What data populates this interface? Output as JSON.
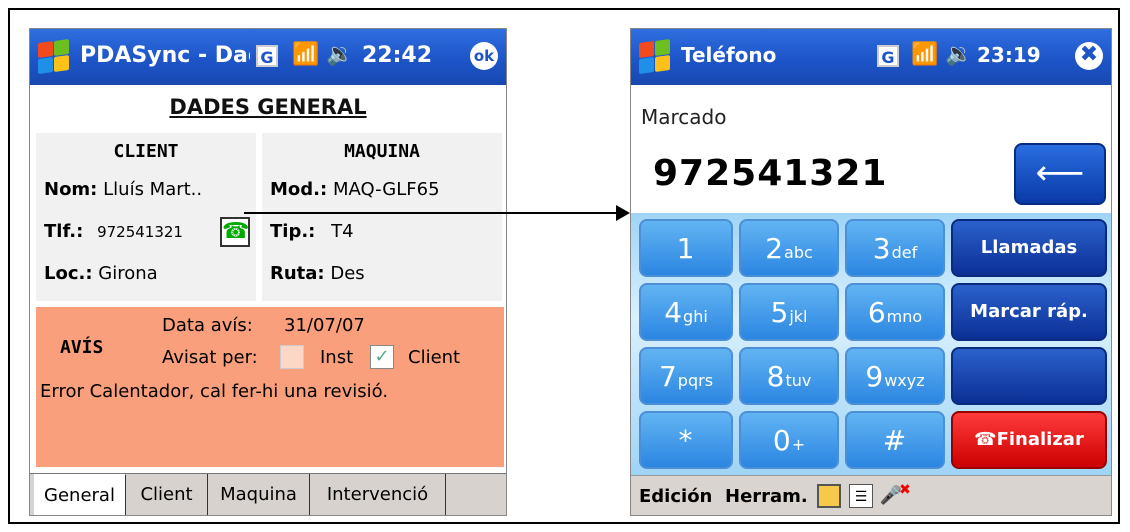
{
  "left": {
    "title": "PDASync - Dadi",
    "g_badge": "G",
    "time": "22:42",
    "ok": "ok",
    "heading": "DADES GENERAL",
    "client": {
      "header": "CLIENT",
      "nom_label": "Nom:",
      "nom_value": "Lluís Mart..",
      "tlf_label": "Tlf.:",
      "tlf_value": "972541321",
      "loc_label": "Loc.:",
      "loc_value": "Girona"
    },
    "maquina": {
      "header": "MAQUINA",
      "mod_label": "Mod.:",
      "mod_value": "MAQ-GLF65",
      "tip_label": "Tip.:",
      "tip_value": "T4",
      "ruta_label": "Ruta:",
      "ruta_value": "Des"
    },
    "avis": {
      "label": "AVÍS",
      "data_label": "Data avís:",
      "data_value": "31/07/07",
      "avisat_label": "Avisat per:",
      "inst": "Inst",
      "client": "Client",
      "inst_checked": false,
      "client_checked": true,
      "message": "Error Calentador, cal fer-hi una revisió."
    },
    "tabs": [
      "General",
      "Client",
      "Maquina",
      "Intervenció"
    ],
    "active_tab": "General"
  },
  "right": {
    "title": "Teléfono",
    "g_badge": "G",
    "time": "23:19",
    "marcado": "Marcado",
    "number": "972541321",
    "keys": [
      {
        "d": "1",
        "s": ""
      },
      {
        "d": "2",
        "s": "abc"
      },
      {
        "d": "3",
        "s": "def"
      },
      {
        "d": "4",
        "s": "ghi"
      },
      {
        "d": "5",
        "s": "jkl"
      },
      {
        "d": "6",
        "s": "mno"
      },
      {
        "d": "7",
        "s": "pqrs"
      },
      {
        "d": "8",
        "s": "tuv"
      },
      {
        "d": "9",
        "s": "wxyz"
      },
      {
        "d": "*",
        "s": ""
      },
      {
        "d": "0",
        "s": "+"
      },
      {
        "d": "#",
        "s": ""
      }
    ],
    "fn_llamadas": "Llamadas",
    "fn_marcar": "Marcar ráp.",
    "fn_finalizar": "Finalizar",
    "menu_edicion": "Edición",
    "menu_herram": "Herram."
  },
  "colors": {
    "titlebar": "#1d55c8",
    "avis_bg": "#fa9f7b",
    "finalizar": "#e00000",
    "key_blue": "#3a94e8"
  }
}
